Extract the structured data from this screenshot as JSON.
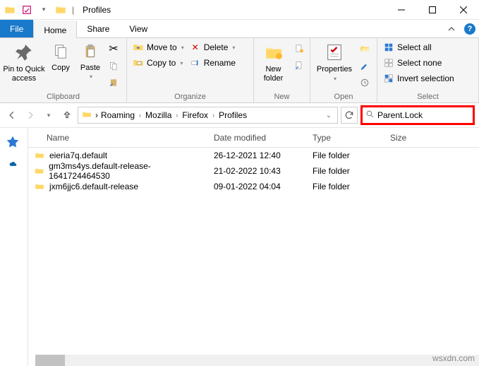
{
  "window": {
    "title": "Profiles"
  },
  "tabs": {
    "file": "File",
    "home": "Home",
    "share": "Share",
    "view": "View"
  },
  "ribbon": {
    "clipboard": {
      "label": "Clipboard",
      "pin": "Pin to Quick access",
      "copy": "Copy",
      "paste": "Paste"
    },
    "organize": {
      "label": "Organize",
      "moveto": "Move to",
      "copyto": "Copy to",
      "delete": "Delete",
      "rename": "Rename"
    },
    "new": {
      "label": "New",
      "newfolder": "New folder"
    },
    "open": {
      "label": "Open",
      "properties": "Properties"
    },
    "select": {
      "label": "Select",
      "all": "Select all",
      "none": "Select none",
      "invert": "Invert selection"
    }
  },
  "breadcrumbs": [
    "Roaming",
    "Mozilla",
    "Firefox",
    "Profiles"
  ],
  "search": {
    "value": "Parent.Lock"
  },
  "columns": {
    "name": "Name",
    "date": "Date modified",
    "type": "Type",
    "size": "Size"
  },
  "rows": [
    {
      "name": "eieria7q.default",
      "date": "26-12-2021 12:40",
      "type": "File folder"
    },
    {
      "name": "gm3ms4ys.default-release-1641724464530",
      "date": "21-02-2022 10:43",
      "type": "File folder"
    },
    {
      "name": "jxm6jjc6.default-release",
      "date": "09-01-2022 04:04",
      "type": "File folder"
    }
  ],
  "watermark": "wsxdn.com"
}
